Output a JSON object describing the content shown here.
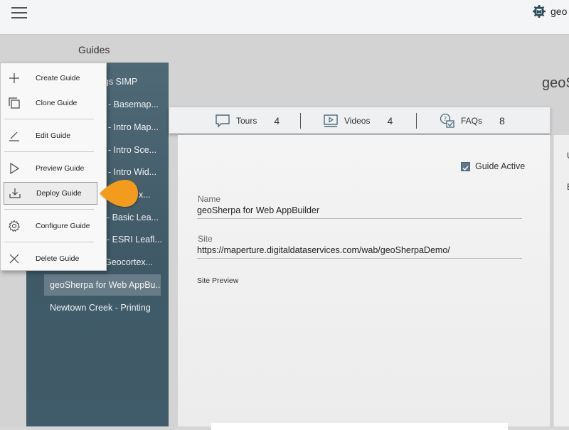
{
  "topbar": {
    "brand_text": "geo",
    "brand_icon": "gear-map-icon"
  },
  "guides_heading": "Guides",
  "right_title": "geoS",
  "menu": {
    "items": [
      {
        "label": "Create Guide",
        "icon": "plus-icon"
      },
      {
        "label": "Clone Guide",
        "icon": "clone-icon"
      },
      {
        "label": "Edit Guide",
        "icon": "pencil-icon"
      },
      {
        "label": "Preview Guide",
        "icon": "play-icon"
      },
      {
        "label": "Deploy Guide",
        "icon": "download-icon"
      },
      {
        "label": "Configure Guide",
        "icon": "gear-icon"
      },
      {
        "label": "Delete Guide",
        "icon": "close-icon"
      }
    ],
    "highlighted_item": "Deploy Guide"
  },
  "guide_list": [
    "gs SIMP",
    "- Basemap...",
    "- Intro Map...",
    "- Intro Sce...",
    "- Intro Wid...",
    "x...",
    "- Basic Lea...",
    "- ESRI Leafl...",
    "Geocortex...",
    "geoSherpa for Web AppBu...",
    "Newtown Creek - Printing"
  ],
  "selected_guide": "geoSherpa for Web AppBu...",
  "stats": {
    "tours": {
      "label": "Tours",
      "count": "4",
      "icon": "tours-icon"
    },
    "videos": {
      "label": "Videos",
      "count": "4",
      "icon": "videos-icon"
    },
    "faqs": {
      "label": "FAQs",
      "count": "8",
      "icon": "faqs-icon"
    }
  },
  "form": {
    "guide_active_label": "Guide Active",
    "guide_active_checked": true,
    "name_label": "Name",
    "name_value": "geoSherpa for Web AppBuilder",
    "site_label": "Site",
    "site_value": "https://maperture.digitaldataservices.com/wab/geoSherpaDemo/",
    "site_preview_label": "Site Preview"
  },
  "right_panel_letters": [
    "U",
    "E"
  ],
  "colors": {
    "sidebar": "#435e6c",
    "accent_orange": "#f39c1e",
    "checkbox": "#5e7a8a"
  }
}
